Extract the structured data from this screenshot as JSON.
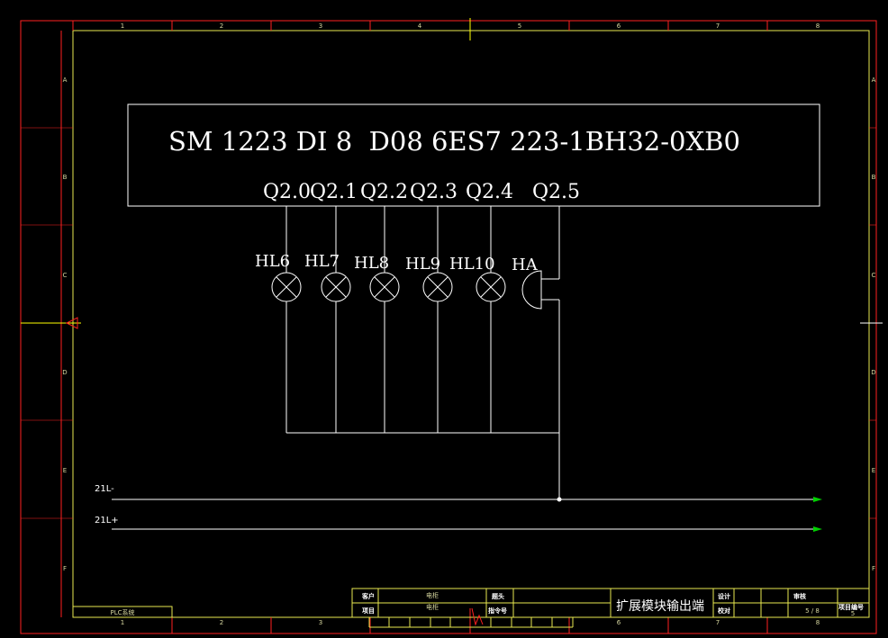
{
  "module": {
    "title": "SM 1223 DI 8  D08 6ES7 223-1BH32-0XB0",
    "outputs": [
      "Q2.0",
      "Q2.1",
      "Q2.2",
      "Q2.3",
      "Q2.4",
      "Q2.5"
    ]
  },
  "loads": [
    {
      "label": "HL6",
      "type": "lamp"
    },
    {
      "label": "HL7",
      "type": "lamp"
    },
    {
      "label": "HL8",
      "type": "lamp"
    },
    {
      "label": "HL9",
      "type": "lamp"
    },
    {
      "label": "HL10",
      "type": "lamp"
    },
    {
      "label": "HA",
      "type": "buzzer"
    }
  ],
  "nets": {
    "minus": "21L-",
    "plus": "21L+"
  },
  "frame": {
    "columns": [
      "1",
      "2",
      "3",
      "4",
      "5",
      "6",
      "7",
      "8"
    ],
    "rows": [
      "A",
      "B",
      "C",
      "D",
      "E",
      "F"
    ]
  },
  "title_block": {
    "customer_label": "客户",
    "customer_value": "电柜",
    "project_label": "项目",
    "project_value": "电柜",
    "drawing_title": "扩展模块输出端",
    "head_label": "题头",
    "order_label": "指令号",
    "design_label": "设计",
    "check_label": "校对",
    "approve_label": "审核",
    "page": "5 / 8",
    "project_no_label": "项目编号",
    "project_no_value": "5",
    "left_tag": "PLC系统"
  },
  "colors": {
    "background": "#000000",
    "frame_line": "#ffff00",
    "outer_frame": "#ff0000",
    "wire": "#ffffff",
    "arrow": "#00ff00"
  }
}
